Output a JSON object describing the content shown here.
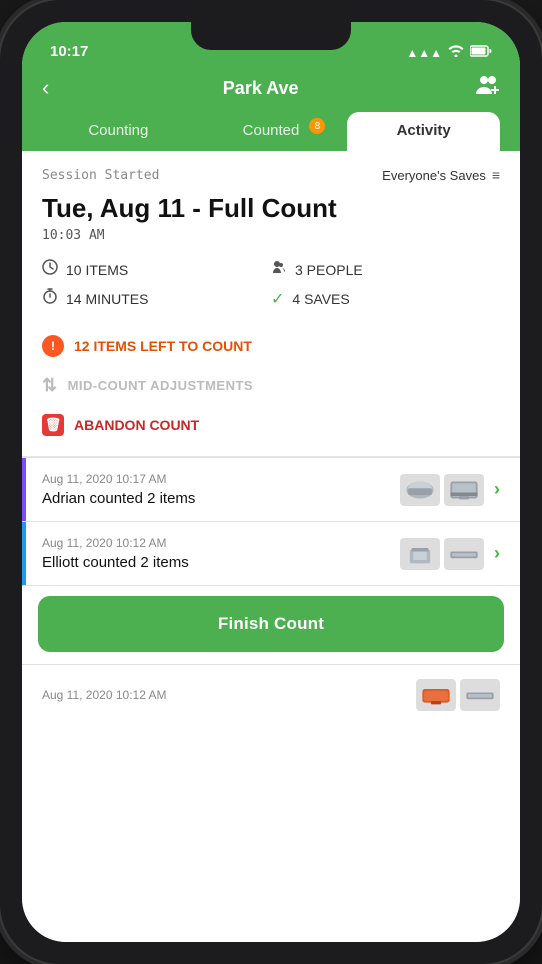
{
  "phone": {
    "status": {
      "time": "10:17",
      "signal": "▲▲▲",
      "wifi": "wifi",
      "battery": "battery"
    }
  },
  "header": {
    "title": "Park Ave",
    "back_label": "‹",
    "add_person_label": "👤+"
  },
  "tabs": [
    {
      "id": "counting",
      "label": "Counting",
      "active": false,
      "badge": null
    },
    {
      "id": "counted",
      "label": "Counted",
      "active": false,
      "badge": "8"
    },
    {
      "id": "activity",
      "label": "Activity",
      "active": true,
      "badge": null
    }
  ],
  "session": {
    "label": "Session Started",
    "filter_label": "Everyone's Saves",
    "title": "Tue, Aug 11 - Full Count",
    "time": "10:03 AM",
    "stats": [
      {
        "icon": "clock",
        "value": "10 ITEMS"
      },
      {
        "icon": "people",
        "value": "3 PEOPLE"
      },
      {
        "icon": "timer",
        "value": "14 MINUTES"
      },
      {
        "icon": "check",
        "value": "4 SAVES"
      }
    ],
    "alert": {
      "icon": "!",
      "label": "12 ITEMS LEFT TO COUNT"
    },
    "mid_count": {
      "label": "MID-COUNT ADJUSTMENTS",
      "icon": "⇅"
    },
    "abandon": {
      "icon": "🗑",
      "label": "ABANDON COUNT"
    }
  },
  "activity_items": [
    {
      "date": "Aug 11, 2020 10:17 AM",
      "description": "Adrian counted 2 items",
      "color": "purple",
      "has_thumbnails": true
    },
    {
      "date": "Aug 11, 2020 10:12 AM",
      "description": "Elliott counted 2 items",
      "color": "blue",
      "has_thumbnails": true
    }
  ],
  "partial_item": {
    "date": "Aug 11, 2020 10:12 AM"
  },
  "footer": {
    "finish_button": "Finish Count"
  }
}
